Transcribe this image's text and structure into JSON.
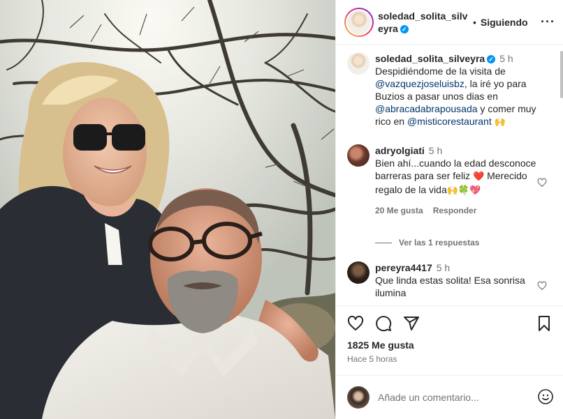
{
  "post": {
    "username": "soledad_solita_silveyra",
    "verified_mark": "✓",
    "separator": "•",
    "follow_label": "Siguiendo",
    "more_label": "···",
    "caption": {
      "time": "5 h",
      "text_1": "Despidiéndome de la visita de ",
      "mention_1": "@vazquezjoseluisbz",
      "text_2": ", la iré yo para Buzios a pasar unos dias en ",
      "mention_2": "@abracadabrapousada",
      "text_3": " y comer muy rico en ",
      "mention_3": "@misticorestaurant",
      "emoji": "🙌"
    },
    "comments": [
      {
        "username": "adryolgiati",
        "time": "5 h",
        "text_1": "Bien ahí...cuando la edad desconoce barreras para ser feliz ",
        "emoji_1": "❤️",
        "text_2": " Merecido regalo de la vida",
        "emoji_2": "🙌🍀💖",
        "likes": "20 Me gusta",
        "reply_label": "Responder",
        "view_replies": "Ver las 1 respuestas"
      },
      {
        "username": "pereyra4417",
        "time": "5 h",
        "text": "Que linda estas solita! Esa sonrisa ilumina"
      }
    ],
    "likes_count": "1825 Me gusta",
    "posted_ago": "Hace 5 horas",
    "add_comment_placeholder": "Añade un comentario..."
  },
  "icons": {
    "like": "heart-icon",
    "comment": "comment-icon",
    "share": "send-icon",
    "save": "bookmark-icon",
    "emoji": "smiley-icon",
    "more": "more-options-icon"
  },
  "colors": {
    "verified": "#0095f6",
    "mention": "#00376b",
    "secondary_text": "#737373",
    "border": "#efefef"
  }
}
